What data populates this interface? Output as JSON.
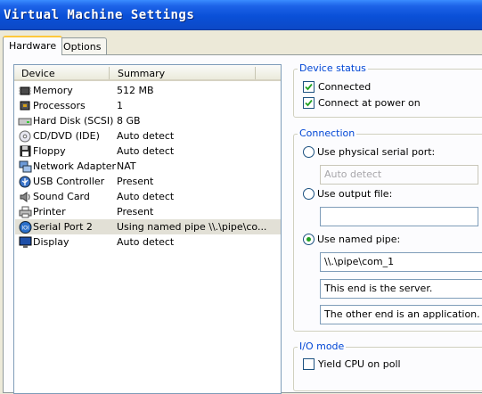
{
  "window": {
    "title": "Virtual Machine Settings"
  },
  "tabs": [
    {
      "label": "Hardware"
    },
    {
      "label": "Options"
    }
  ],
  "device_list": {
    "col_device": "Device",
    "col_summary": "Summary",
    "rows": [
      {
        "name": "Memory",
        "summary": "512 MB",
        "icon": "memory-icon"
      },
      {
        "name": "Processors",
        "summary": "1",
        "icon": "processor-icon"
      },
      {
        "name": "Hard Disk (SCSI)",
        "summary": "8 GB",
        "icon": "hard-disk-icon"
      },
      {
        "name": "CD/DVD (IDE)",
        "summary": "Auto detect",
        "icon": "cd-dvd-icon"
      },
      {
        "name": "Floppy",
        "summary": "Auto detect",
        "icon": "floppy-icon"
      },
      {
        "name": "Network Adapter",
        "summary": "NAT",
        "icon": "network-adapter-icon"
      },
      {
        "name": "USB Controller",
        "summary": "Present",
        "icon": "usb-icon"
      },
      {
        "name": "Sound Card",
        "summary": "Auto detect",
        "icon": "sound-card-icon"
      },
      {
        "name": "Printer",
        "summary": "Present",
        "icon": "printer-icon"
      },
      {
        "name": "Serial Port 2",
        "summary": "Using named pipe \\\\.\\pipe\\co...",
        "icon": "serial-port-icon",
        "selected": true
      },
      {
        "name": "Display",
        "summary": "Auto detect",
        "icon": "display-icon"
      }
    ]
  },
  "device_status": {
    "title": "Device status",
    "connected": {
      "label": "Connected",
      "checked": true
    },
    "connect_at_power_on": {
      "label": "Connect at power on",
      "checked": true
    }
  },
  "connection": {
    "title": "Connection",
    "use_physical": {
      "label": "Use physical serial port:",
      "selected": false
    },
    "physical_value": "Auto detect",
    "use_output_file": {
      "label": "Use output file:",
      "selected": false
    },
    "output_file_value": "",
    "use_named_pipe": {
      "label": "Use named pipe:",
      "selected": true
    },
    "pipe_name": "\\\\.\\pipe\\com_1",
    "this_end": "This end is the server.",
    "other_end": "The other end is an application."
  },
  "io_mode": {
    "title": "I/O mode",
    "yield_cpu": {
      "label": "Yield CPU on poll",
      "checked": false
    }
  },
  "colors": {
    "title_bar": "#0a50d8",
    "group_title": "#0046d5",
    "dialog_bg": "#ece9d8",
    "selected_row": "#e2e0d6"
  }
}
